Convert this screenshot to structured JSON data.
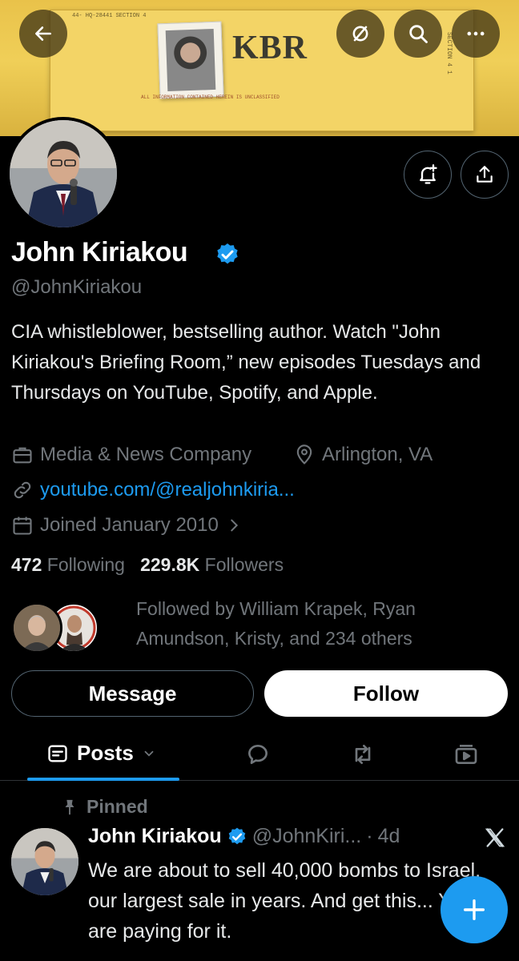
{
  "banner": {
    "logo_text": "KBR",
    "stamp_text": "44- HQ-28441   SECTION 4",
    "note_text": "ALL INFORMATION CONTAINED HEREIN IS UNCLASSIFIED",
    "side_text": "SECTION 4  1"
  },
  "header": {
    "back_icon": "arrow-left-icon",
    "mute_icon": "eye-off-icon",
    "search_icon": "search-icon",
    "more_icon": "more-horizontal-icon",
    "notify_icon": "bell-plus-icon",
    "share_icon": "share-icon"
  },
  "profile": {
    "name": "John Kiriakou",
    "handle": "@JohnKiriakou",
    "bio": "CIA whistleblower, bestselling author. Watch \"John Kiriakou's Briefing Room,” new episodes Tuesdays and Thursdays on YouTube, Spotify, and Apple.",
    "category": "Media & News Company",
    "location": "Arlington, VA",
    "website": "youtube.com/@realjohnkiria...",
    "joined": "Joined January 2010",
    "following_count": "472",
    "following_label": "Following",
    "followers_count": "229.8K",
    "followers_label": "Followers",
    "followed_by": "Followed by William Krapek, Ryan Amundson, Kristy, and 234 others"
  },
  "actions": {
    "message_label": "Message",
    "follow_label": "Follow"
  },
  "tabs": {
    "posts_label": "Posts"
  },
  "pinned_post": {
    "pinned_label": "Pinned",
    "author_name": "John Kiriakou",
    "author_handle": "@JohnKiri...",
    "separator": "·",
    "time": "4d",
    "text": "We are about to sell 40,000 bombs to Israel, our largest sale in years. And get this... YOU are paying for it."
  },
  "colors": {
    "accent": "#1d9bf0",
    "background": "#000000",
    "muted": "#71767b",
    "verified": "#1d9bf0"
  }
}
